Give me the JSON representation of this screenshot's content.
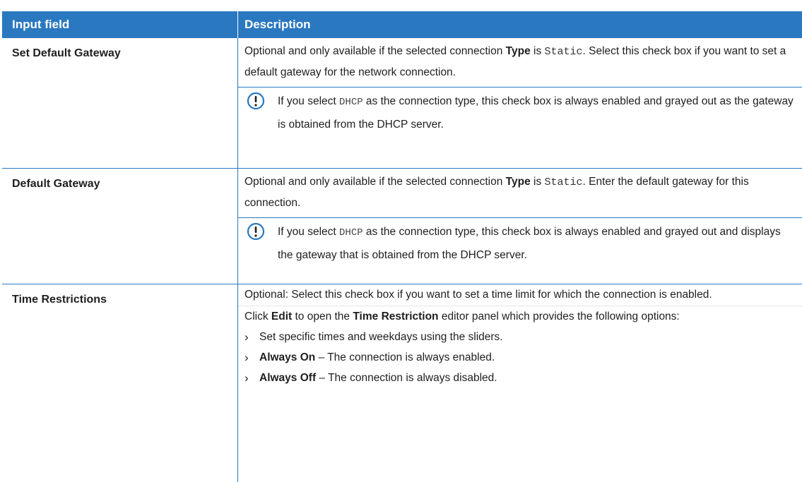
{
  "header": {
    "col1": "Input field",
    "col2": "Description"
  },
  "rows": [
    {
      "field": "Set Default Gateway",
      "desc_a": "Optional and only available if the selected connection ",
      "desc_b": "Type",
      "desc_c": " is ",
      "desc_code": "Static",
      "desc_d": ". Select this check box if you want to set a default gateway for the network connection.",
      "note_a": "If you select ",
      "note_code": "DHCP",
      "note_b": " as the connection type, this check box is always enabled and grayed out as the gateway is obtained from the DHCP server."
    },
    {
      "field": "Default Gateway",
      "desc_a": "Optional and only available if the selected connection ",
      "desc_b": "Type",
      "desc_c": " is ",
      "desc_code": "Static",
      "desc_d": ". Enter the default gateway for this connection.",
      "note_a": "If you select ",
      "note_code": "DHCP",
      "note_b": " as the connection type, this check box is always enabled and grayed out and displays the gateway that is obtained from the DHCP server."
    },
    {
      "field": "Time Restrictions",
      "desc": "Optional: Select this check box if you want to set a time limit for which the connection is enabled.",
      "click_a": "Click ",
      "click_edit": "Edit",
      "click_b": " to open the ",
      "click_tr": "Time Restriction",
      "click_c": " editor panel which provides the following options:",
      "bullets": [
        {
          "bold": "",
          "text": "Set specific times and weekdays using the sliders."
        },
        {
          "bold": "Always On",
          "text": " – The connection is always enabled."
        },
        {
          "bold": "Always Off",
          "text": " – The connection is always disabled."
        }
      ]
    }
  ],
  "icons": {
    "note": "exclamation-circle-icon",
    "bullet": "chevron-right-icon"
  },
  "colors": {
    "accent": "#2a78c0"
  }
}
